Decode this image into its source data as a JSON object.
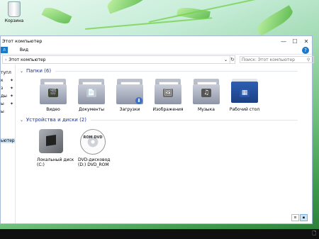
{
  "desktop": {
    "recycle_bin_label": "Корзина"
  },
  "window": {
    "title": "Этот компьютер",
    "controls": {
      "minimize": "—",
      "maximize": "☐",
      "close": "✕"
    },
    "ribbon": {
      "file": "л",
      "tabs": [
        "Вид"
      ],
      "help": "?"
    },
    "address": {
      "path_root": "Этот компьютер",
      "chevron": "›",
      "dropdown": "⌄",
      "refresh": "↻"
    },
    "search": {
      "placeholder": "Поиск: Этот компьютер",
      "icon": "⚲"
    },
    "nav": {
      "items": [
        "тупл",
        "к",
        "з",
        "ды",
        "ы",
        "ы",
        "ьютер"
      ]
    },
    "groups": {
      "folders_header": "Папки (6)",
      "devices_header": "Устройства и диски (2)"
    },
    "folders": [
      {
        "label": "Видео",
        "emblem": "🎬",
        "color": "#3b4a2b"
      },
      {
        "label": "Документы",
        "emblem": "📄",
        "color": "#c9c9c9"
      },
      {
        "label": "Загрузки",
        "emblem": "⬇",
        "color": "#3b6fc8"
      },
      {
        "label": "Изображения",
        "emblem": "🖼",
        "color": "#6b6b6b"
      },
      {
        "label": "Музыка",
        "emblem": "♫",
        "color": "#555555"
      },
      {
        "label": "Рабочий стол",
        "emblem": "▦",
        "color": "#2b59a8"
      }
    ],
    "drives": [
      {
        "label_1": "Локальный диск",
        "label_2": "(C:)"
      },
      {
        "label_1": "DVD-дисковод",
        "label_2": "(D:) DVD_ROM",
        "disc_text": "ROM DVD"
      }
    ],
    "view_buttons": [
      "≡",
      "▪"
    ]
  },
  "taskbar": {
    "corner_icon": "🗋"
  }
}
